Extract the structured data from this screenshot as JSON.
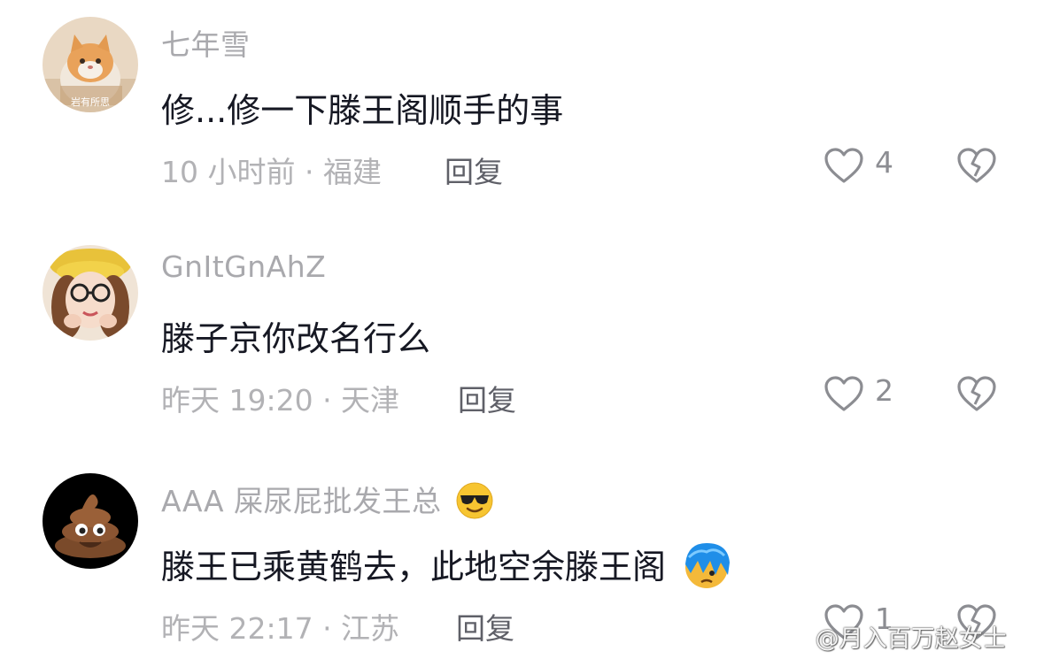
{
  "comments": [
    {
      "username": "七年雪",
      "text": "修...修一下滕王阁顺手的事",
      "meta": "10 小时前 · 福建",
      "reply": "回复",
      "likes": "4",
      "avatar_caption": "岩有所思"
    },
    {
      "username": "GnItGnAhZ",
      "text": "滕子京你改名行么",
      "meta": "昨天 19:20 · 天津",
      "reply": "回复",
      "likes": "2"
    },
    {
      "username": "AAA 屎尿屁批发王总",
      "text": "滕王已乘黄鹤去，此地空余滕王阁",
      "meta": "昨天 22:17 · 江苏",
      "reply": "回复",
      "likes": "1"
    }
  ],
  "watermark": {
    "text": "@月入百万赵女士"
  },
  "icons": {
    "like": "heart-outline-icon",
    "dislike": "broken-heart-icon"
  }
}
